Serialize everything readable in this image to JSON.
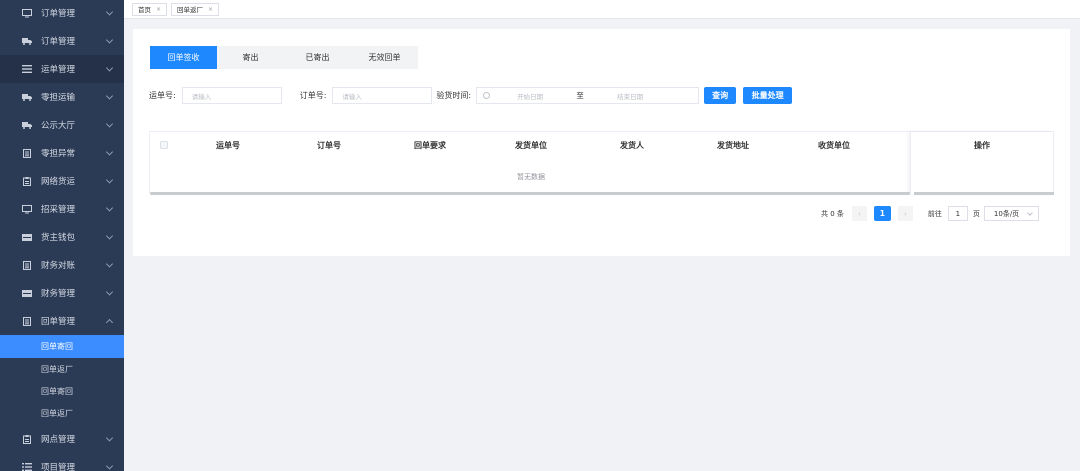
{
  "sidebar": {
    "items": [
      {
        "label": "订单管理",
        "icon": "monitor-icon"
      },
      {
        "label": "订单管理",
        "icon": "truck-icon"
      },
      {
        "label": "运单管理",
        "icon": "list-icon"
      },
      {
        "label": "零担运输",
        "icon": "truck-icon"
      },
      {
        "label": "公示大厅",
        "icon": "truck-icon"
      },
      {
        "label": "零担异常",
        "icon": "document-icon"
      },
      {
        "label": "网络货运",
        "icon": "clipboard-icon"
      },
      {
        "label": "招采管理",
        "icon": "monitor-icon"
      },
      {
        "label": "货主钱包",
        "icon": "wallet-icon"
      },
      {
        "label": "财务对账",
        "icon": "document-icon"
      },
      {
        "label": "财务管理",
        "icon": "wallet-icon"
      },
      {
        "label": "回单管理",
        "icon": "document-icon"
      }
    ],
    "sub_items": [
      {
        "label": "回单寄回"
      },
      {
        "label": "回单返厂"
      },
      {
        "label": "回单寄回"
      },
      {
        "label": "回单返厂"
      }
    ],
    "after_items": [
      {
        "label": "网点管理",
        "icon": "clipboard-icon"
      },
      {
        "label": "项目管理",
        "icon": "list-icon"
      }
    ]
  },
  "tags": [
    {
      "label": "首页"
    },
    {
      "label": "回单返厂"
    }
  ],
  "tabs": [
    {
      "label": "回单签收"
    },
    {
      "label": "寄出"
    },
    {
      "label": "已寄出"
    },
    {
      "label": "无效回单"
    }
  ],
  "filters": {
    "waybill_label": "运单号:",
    "waybill_placeholder": "请输入",
    "order_label": "订单号:",
    "order_placeholder": "请输入",
    "date_label": "验货时间:",
    "date_start": "开始日期",
    "date_sep": "至",
    "date_end": "结束日期",
    "query_button": "查询",
    "batch_button": "批量处理"
  },
  "table": {
    "columns": [
      "运单号",
      "订单号",
      "回单要求",
      "发货单位",
      "发货人",
      "发货地址",
      "收货单位"
    ],
    "action_column": "操作",
    "empty_text": "暂无数据"
  },
  "pagination": {
    "total": "共 0 条",
    "current_page": "1",
    "goto_label": "前往",
    "goto_value": "1",
    "page_unit": "页",
    "page_size": "10条/页"
  }
}
